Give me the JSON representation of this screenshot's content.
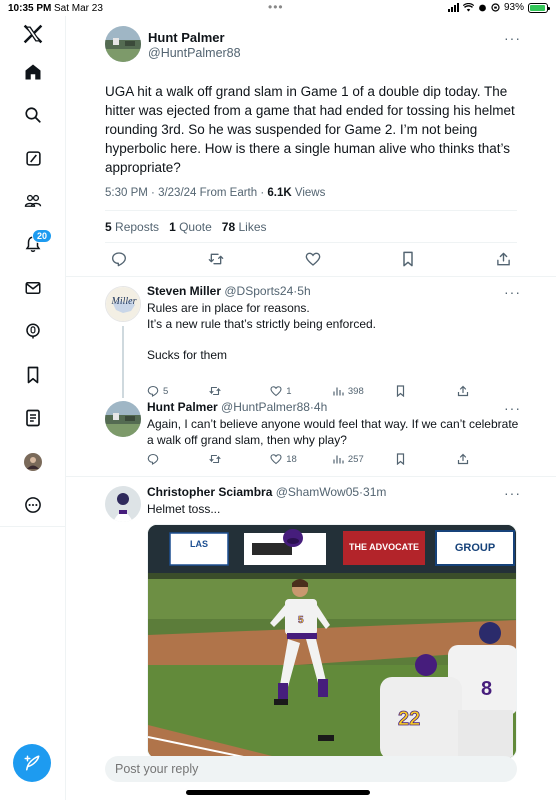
{
  "status_bar": {
    "time": "10:35 PM",
    "date": "Sat Mar 23",
    "battery": "93%",
    "battery_level": 0.93
  },
  "sidebar": {
    "items": [
      {
        "icon": "x-logo-icon"
      },
      {
        "icon": "home-icon"
      },
      {
        "icon": "search-icon"
      },
      {
        "icon": "grok-icon"
      },
      {
        "icon": "communities-icon"
      },
      {
        "icon": "notifications-icon",
        "badge": "20"
      },
      {
        "icon": "messages-icon"
      },
      {
        "icon": "spaces-icon"
      },
      {
        "icon": "bookmarks-icon"
      },
      {
        "icon": "lists-icon"
      },
      {
        "icon": "profile-avatar"
      },
      {
        "icon": "more-icon"
      }
    ],
    "compose_icon": "compose-icon"
  },
  "tweet": {
    "author": "Hunt Palmer",
    "handle": "@HuntPalmer88",
    "text": "UGA hit a walk off grand slam in Game 1 of a double dip today. The hitter was ejected from a game that had ended for tossing his helmet rounding 3rd. So he was suspended for Game 2. I’m not being hyperbolic here. How is there a single human alive who thinks that’s appropriate?",
    "time": "5:30 PM",
    "date": "3/23/24",
    "source": "From Earth",
    "views": "6.1K",
    "views_label": "Views",
    "reposts": "5",
    "reposts_label": "Reposts",
    "quotes": "1",
    "quotes_label": "Quote",
    "likes": "78",
    "likes_label": "Likes"
  },
  "replies": [
    {
      "author": "Steven Miller",
      "handle": "@DSports24",
      "age": "5h",
      "lines": [
        "Rules are in place for reasons.",
        "It’s a new rule that’s strictly being enforced.",
        "",
        "Sucks for them"
      ],
      "replies": "5",
      "reposts": "",
      "likes": "1",
      "views": "398"
    },
    {
      "author": "Hunt Palmer",
      "handle": "@HuntPalmer88",
      "age": "4h",
      "lines": [
        "Again, I can’t believe anyone would feel that way. If we can’t celebrate a walk off grand slam, then why play?"
      ],
      "replies": "",
      "reposts": "",
      "likes": "18",
      "views": "257"
    },
    {
      "author": "Christopher Sciambra",
      "handle": "@ShamWow05",
      "age": "31m",
      "lines": [
        "Helmet toss..."
      ]
    }
  ],
  "media": {
    "banners": [
      "LAS",
      "",
      "THE ADVOCATE",
      "GROUP"
    ],
    "player_number": "5"
  },
  "reply_bar": {
    "placeholder": "Post your reply"
  },
  "colors": {
    "accent": "#1d9bf0",
    "text": "#0f1419",
    "secondary": "#536471",
    "border": "#eff3f4",
    "lsu_purple": "#461d7c"
  }
}
